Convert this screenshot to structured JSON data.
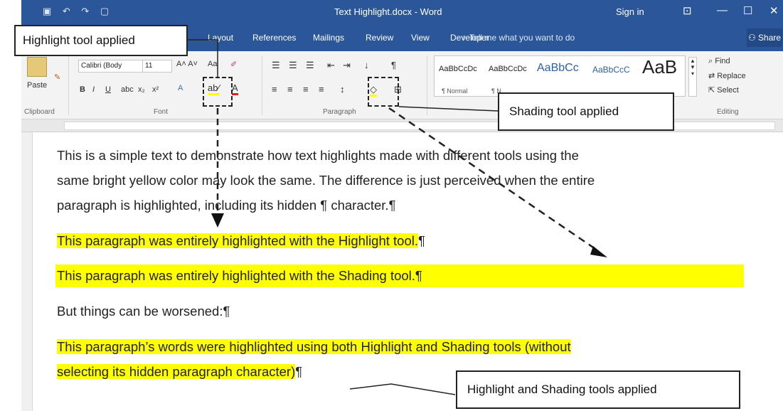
{
  "titlebar": {
    "doc_title": "Text Highlight.docx - Word",
    "sign_in": "Sign in",
    "minimize": "—",
    "maximize": "☐",
    "close": "✕"
  },
  "tabs": [
    "Layout",
    "References",
    "Mailings",
    "Review",
    "View",
    "Developer"
  ],
  "tell_me": "Tell me what you want to do",
  "share": "Share",
  "ribbon": {
    "paste": "Paste",
    "clipboard": "Clipboard",
    "font_name": "Calibri (Body",
    "font_size": "11",
    "font_group": "Font",
    "paragraph_group": "Paragraph",
    "editing_group": "Editing",
    "find": "Find",
    "replace": "Replace",
    "select": "Select",
    "styles": [
      {
        "preview": "AaBbCcDc",
        "name": "¶ Normal"
      },
      {
        "preview": "AaBbCcDc",
        "name": "¶ N"
      },
      {
        "preview": "AaBbCc",
        "name": ""
      },
      {
        "preview": "AaBbCcC",
        "name": ""
      },
      {
        "preview": "AaB",
        "name": ""
      }
    ]
  },
  "callouts": {
    "highlight_tool": "Highlight tool applied",
    "shading_tool": "Shading tool applied",
    "both_tools": "Highlight and Shading tools applied"
  },
  "document": {
    "para1_lines": [
      "This is a simple text to demonstrate how text highlights made with different tools using the",
      "same bright yellow color may look the same. The difference is just perceived when the entire",
      "paragraph is highlighted, including its hidden ¶ character.¶"
    ],
    "para_highlight": "This paragraph was entirely highlighted with the Highlight tool.",
    "para_shading": "This paragraph was entirely highlighted with the Shading tool.",
    "para_worse": "But things can be worsened:¶",
    "para_both_line1": "This paragraph’s words were highlighted using both Highlight and Shading tools (without",
    "para_both_line2": "selecting its hidden paragraph character)",
    "pilcrow": "¶"
  },
  "colors": {
    "word_blue": "#2b579a",
    "highlight_yellow": "#ffff00"
  }
}
